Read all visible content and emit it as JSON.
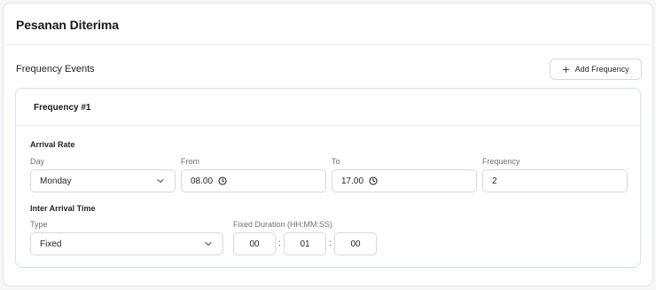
{
  "page": {
    "title": "Pesanan Diterima"
  },
  "frequency_events": {
    "title": "Frequency Events",
    "add_button_label": "Add Frequency",
    "items": [
      {
        "title": "Frequency #1",
        "arrival_rate": {
          "label": "Arrival Rate",
          "day": {
            "label": "Day",
            "value": "Monday"
          },
          "from": {
            "label": "From",
            "value": "08.00"
          },
          "to": {
            "label": "To",
            "value": "17.00"
          },
          "frequency": {
            "label": "Frequency",
            "value": "2"
          }
        },
        "inter_arrival": {
          "label": "Inter Arrival Time",
          "type": {
            "label": "Type",
            "value": "Fixed"
          },
          "fixed_duration": {
            "label": "Fixed Duration (HH:MM:SS)",
            "hh": "00",
            "mm": "01",
            "ss": "00",
            "separator": ":"
          }
        }
      }
    ]
  },
  "icons": {
    "add": "plus-icon",
    "select": "chevron-down-icon",
    "time": "clock-icon"
  },
  "colors": {
    "card_border_accent": "#cfe3ee",
    "border": "#d5d8dc"
  }
}
